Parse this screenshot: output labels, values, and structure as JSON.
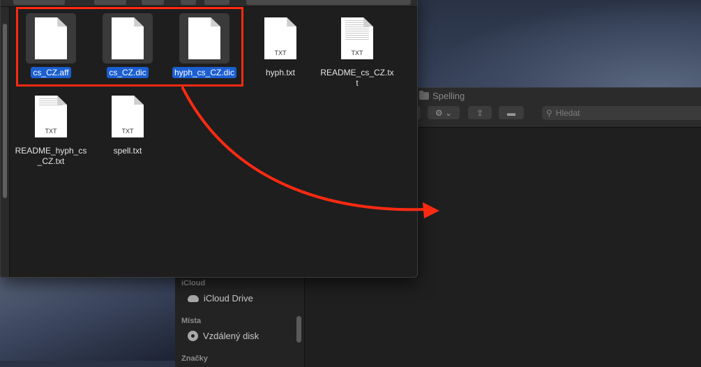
{
  "desktop": {
    "accent": "#1b5fd1",
    "annotation_color": "#ff2a12"
  },
  "front_window": {
    "files": [
      {
        "name": "cs_CZ.aff",
        "selected": true,
        "icon": "document-icon",
        "ext": ""
      },
      {
        "name": "cs_CZ.dic",
        "selected": true,
        "icon": "document-icon",
        "ext": ""
      },
      {
        "name": "hyph_cs_CZ.dic",
        "selected": true,
        "icon": "document-icon",
        "ext": ""
      },
      {
        "name": "hyph.txt",
        "selected": false,
        "icon": "text-file-icon",
        "ext": "TXT"
      },
      {
        "name": "README_cs_CZ.txt",
        "selected": false,
        "icon": "text-file-icon",
        "ext": "TXT"
      },
      {
        "name": "README_hyph_cs_CZ.txt",
        "selected": false,
        "icon": "text-file-icon",
        "ext": "TXT"
      },
      {
        "name": "spell.txt",
        "selected": false,
        "icon": "text-file-icon",
        "ext": "TXT"
      }
    ]
  },
  "back_window": {
    "title": "Spelling",
    "search_placeholder": "Hledat",
    "sidebar": {
      "sections": [
        {
          "label": "iCloud",
          "items": [
            "iCloud Drive"
          ]
        },
        {
          "label": "Místa",
          "items": [
            "Vzdálený disk"
          ]
        },
        {
          "label": "Značky",
          "items": []
        }
      ]
    }
  }
}
